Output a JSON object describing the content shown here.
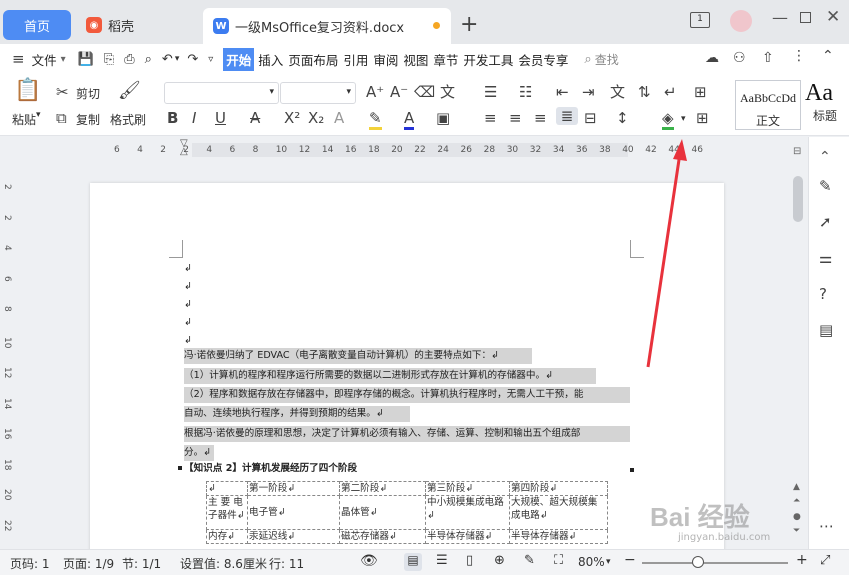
{
  "tabs": {
    "home": "首页",
    "daoke": "稻壳",
    "doc": "一级MsOffice复习资料.docx",
    "new": "+"
  },
  "menu": {
    "file": "文件",
    "items": [
      "开始",
      "插入",
      "页面布局",
      "引用",
      "审阅",
      "视图",
      "章节",
      "开发工具",
      "会员专享"
    ],
    "search": "查找"
  },
  "ribbon": {
    "paste": "粘贴",
    "cut": "剪切",
    "copy": "复制",
    "format_painter": "格式刷",
    "style_normal_preview": "AaBbCcDd",
    "style_normal": "正文",
    "style_heading_preview": "Aa",
    "style_heading": "标题"
  },
  "ruler": {
    "numbers": [
      "6",
      "4",
      "2",
      "2",
      "4",
      "6",
      "8",
      "10",
      "12",
      "14",
      "16",
      "18",
      "20",
      "22",
      "24",
      "26",
      "28",
      "30",
      "32",
      "34",
      "36",
      "38",
      "40",
      "42",
      "44",
      "46"
    ]
  },
  "vruler": {
    "numbers": [
      "2",
      "2",
      "4",
      "6",
      "8",
      "10",
      "12",
      "14",
      "16",
      "18",
      "20",
      "22"
    ]
  },
  "doc": {
    "marks": [
      "↲",
      "↲",
      "↲",
      "↲",
      "↲"
    ],
    "p1": "冯·诺依曼归纳了 EDVAC（电子离散变量自动计算机）的主要特点如下：↲",
    "p2": "（1）计算机的程序和程序运行所需要的数据以二进制形式存放在计算机的存储器中。↲",
    "p3a": "（2）程序和数据存放在存储器中，即程序存储的概念。计算机执行程序时，无需人工干预，能",
    "p3b": "自动、连续地执行程序，并得到预期的结果。↲",
    "p4a": "根据冯·诺依曼的原理和思想，决定了计算机必须有输入、存储、运算、控制和输出五个组成部",
    "p4b": "分。↲",
    "heading": "【知识点 2】计算机发展经历了四个阶段",
    "table": {
      "header": [
        "↲",
        "第一阶段↲",
        "第二阶段↲",
        "第三阶段↲",
        "第四阶段↲"
      ],
      "row1": [
        "主 要 电子器件↲",
        "电子管↲",
        "晶体管↲",
        "中小规模集成电路↲",
        "大规模、超大规模集成电路↲"
      ],
      "row2": [
        "内存↲",
        "汞延迟线↲",
        "磁芯存储器↲",
        "半导体存储器↲",
        "半导体存储器↲"
      ]
    }
  },
  "status": {
    "page_no": "页码: 1",
    "pages": "页面: 1/9",
    "section": "节: 1/1",
    "setting": "设置值: 8.6厘米",
    "row": "行: 11",
    "zoom": "80%"
  },
  "watermark": {
    "line1": "Bai 经验",
    "line2": "jingyan.baidu.com"
  },
  "colors": {
    "accent": "#4e8cf3",
    "arrow": "#e8323c",
    "highlight": "#d4d4d4"
  }
}
